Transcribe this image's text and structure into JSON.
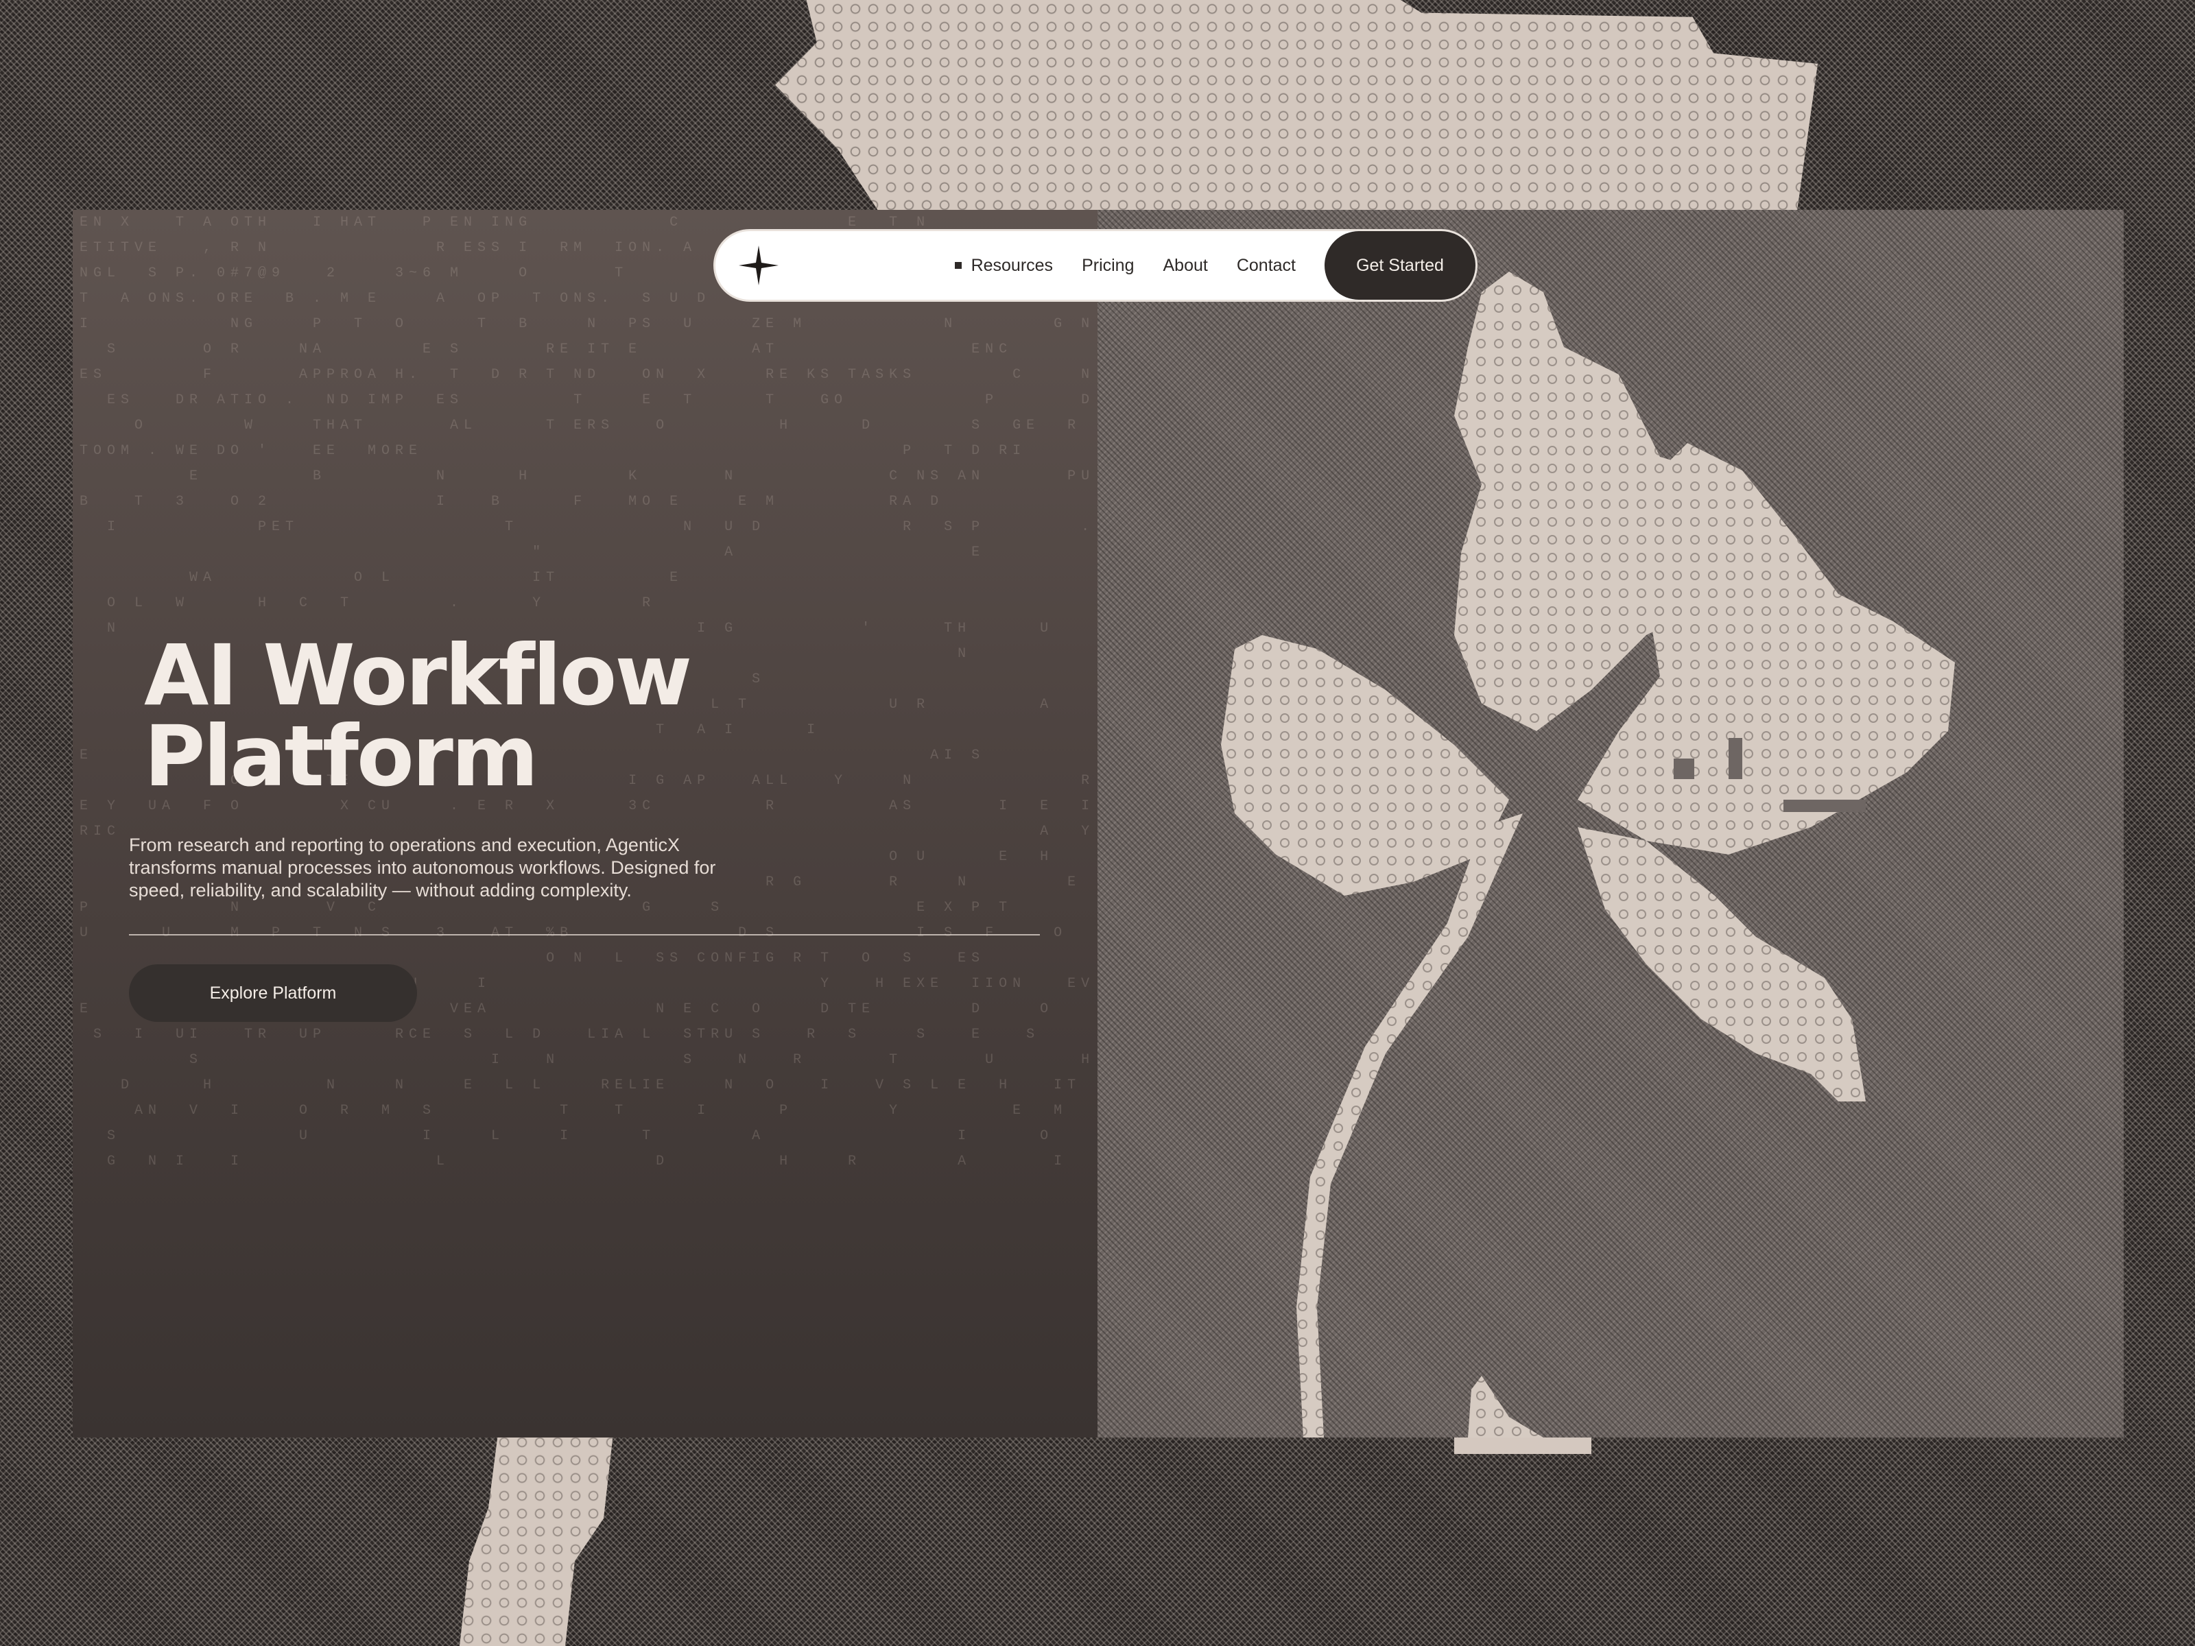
{
  "nav": {
    "logo_icon": "four-point-star-icon",
    "resources_icon": "square-bullet-icon",
    "items": [
      {
        "label": "Resources"
      },
      {
        "label": "Pricing"
      },
      {
        "label": "About"
      },
      {
        "label": "Contact"
      }
    ],
    "cta_label": "Get Started"
  },
  "hero": {
    "title": "AI Workflow Platform",
    "description": "From research and reporting to operations and execution, AgenticX transforms manual processes into autonomous workflows. Designed for speed, reliability, and scalability — without adding complexity.",
    "button_label": "Explore Platform"
  },
  "background_text": "EN X   T A OTH   I HAT   P EN ING          C            E  T N              O D A  A\nETITVE   , R N            R ESS I  RM  ION. A    E    R       O                            \nNGL  S P. 0#7@9   2    3~6 M    O      T       EA       E  O                              \nT  A ONS. ORE  B . M E    A  OP  T ONS.  S U D    A T M                                 \nI          NG    P  T  O     T  B    N  PS  U    ZE M          N       G NI  TASK ,  V    RE  T\n  S      O R    NA       E S      RE IT E        AT              ENC         S  D    L B Y      IC\nES       F      APPROA H.  T  D R T ND   ON  X    RE KS TASKS       C    N   X    E  W R F OW  T P Y ST\n  ES   DR ATIO .  ND IMP  ES        T    E  T     T   GO          P      D        A      F     H\n    O       W    THAT      AL     T ERS   O        H     D       S  GE  R  E  E  N   S      H     G NERAT\nTOOM . WE DO '   EE  MORE                                   P  T D RI          RK. WE N E      E\n        E        B        N     H       K      N           C NS AN      PU     C N     T      O    MA ABE E T\nB   T  3   O 2            I   B     F   MO E    E M        RA D            .         I E  S\n  I          PET               T            N  U D          R  S P       .    E         B\n                                 \"             A                 E          I             H Y  I\n        WA          O L          IT        E                                Y        R        BU   HE\n  O L  W     H  C  T       .     Y       R\n  N                                          I G         '     TH     U        ORK  TH      U\n                                                                N            N        E  CU  Q  E  T\n                                                 S\n                                              L T          U R        A                I\n                                          T  A I     I                     H Y N B  R   A\nE                                                             AI S                 \n           O     NTE     O  A           I G AP   ALL   Y    N            R             F U\nE Y  UA  F O       X CU    . E R  X     3C        R        AS      I  E  I  D    R  O    HA\nRIC                                                                   A  Y\n                                                           O U     E  H\n                                                  R G      R    N       E S     NE A I\nP          N      V  C                   G    S              E X P T           L T  NO  L\nU     U    M  P  T  N S   3   AT  %B            D S          I S  F    O  T  FE T  E    OPL\n                                  O N  L  SS CONFIG R T  O  S   ES           A              QU\n                    I   N    I                        Y   H EXE  IION   EV  Y   H  MAC  I\nE                          VEA            N E C  O    D TE       D    O        EN\n S  I  UI   TR  UP     RCE  S  L D   LIA L  STRU S   R  S    S   E   S     E\n        S                     I   N         S   N   R      T      U      H       I\n   D     H        N    N    E  L L    RELIE    N  O   I   V S L E  H   IT     R A     I   H\n    AN  V  I    O  R  M  S         T   T     I     P       Y        E  M   A  S  S\n  S             U        I    L    I     T       A              I     O             \n  G  N I   I              L               D        H    R       A      I         I"
}
